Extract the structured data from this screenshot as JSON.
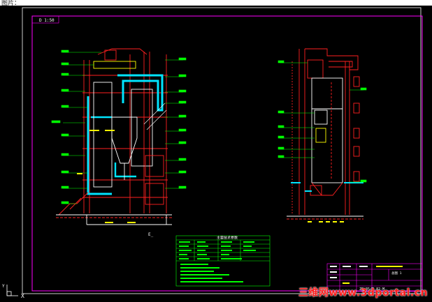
{
  "header": {
    "label": "图片："
  },
  "drawing": {
    "sheet_tag": "D 1:50",
    "table_title": "主要技术参数",
    "title_block": {
      "code": "ZG-35/3.82-M",
      "sheet": "总图 1"
    },
    "colors": {
      "frame": "#ff00ff",
      "steel": "#ff2020",
      "flue": "#00e5ff",
      "label": "#00ff00",
      "yellow": "#ffff00",
      "white": "#ffffff"
    }
  },
  "watermark": "三维网www.3dportal.cn",
  "ucs": {
    "y": "Y",
    "x": "X"
  }
}
